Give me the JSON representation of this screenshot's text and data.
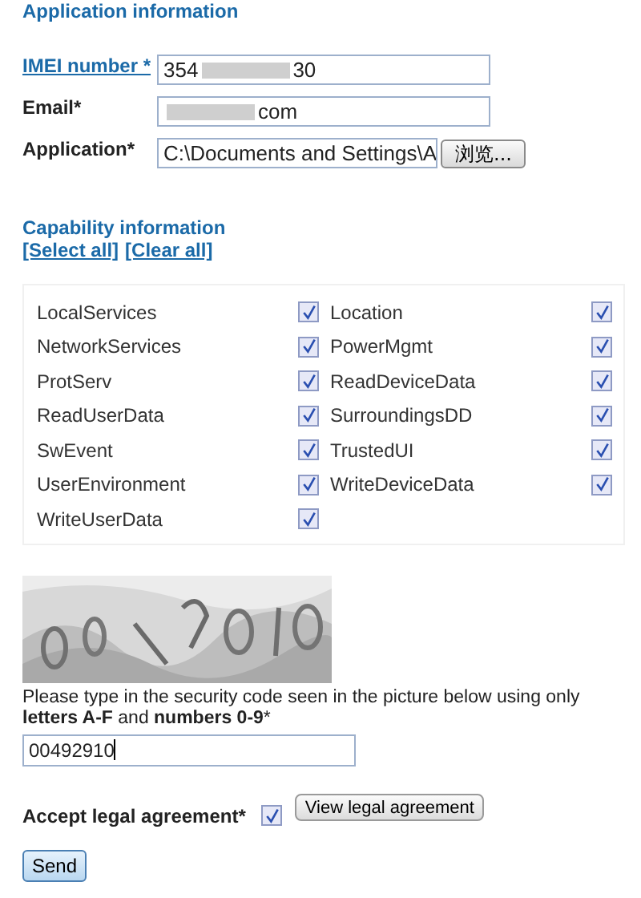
{
  "application_section": {
    "title": "Application information",
    "fields": [
      {
        "kind": "link",
        "label": "IMEI number *",
        "value_parts": [
          {
            "kind": "text",
            "text": "354"
          },
          {
            "kind": "blurred"
          },
          {
            "kind": "text",
            "text": "30"
          }
        ]
      },
      {
        "kind": "plain",
        "label": "Email*",
        "value_parts": [
          {
            "kind": "blurred"
          },
          {
            "kind": "text",
            "text": "com"
          }
        ]
      },
      {
        "kind": "file",
        "label": "Application*",
        "value_parts": [
          {
            "kind": "text",
            "text": "C:\\Documents and Settings\\A"
          }
        ],
        "button": "浏览..."
      }
    ]
  },
  "capability_section": {
    "title": "Capability information",
    "links": [
      "[Select all]",
      "[Clear all]"
    ],
    "capabilities": [
      {
        "name": "LocalServices",
        "checked": true
      },
      {
        "name": "Location",
        "checked": true
      },
      {
        "name": "NetworkServices",
        "checked": true
      },
      {
        "name": "PowerMgmt",
        "checked": true
      },
      {
        "name": "ProtServ",
        "checked": true
      },
      {
        "name": "ReadDeviceData",
        "checked": true
      },
      {
        "name": "ReadUserData",
        "checked": true
      },
      {
        "name": "SurroundingsDD",
        "checked": true
      },
      {
        "name": "SwEvent",
        "checked": true
      },
      {
        "name": "TrustedUI",
        "checked": true
      },
      {
        "name": "UserEnvironment",
        "checked": true
      },
      {
        "name": "WriteDeviceData",
        "checked": true
      },
      {
        "name": "WriteUserData",
        "checked": true
      }
    ]
  },
  "security": {
    "instruction": "Please type in the security code seen in the picture below using only **letters A-F** and **numbers 0-9***",
    "value": "00492910"
  },
  "agreement": {
    "label": "Accept legal agreement*",
    "checked": true,
    "button": "View legal agreement"
  },
  "submit": "Send"
}
